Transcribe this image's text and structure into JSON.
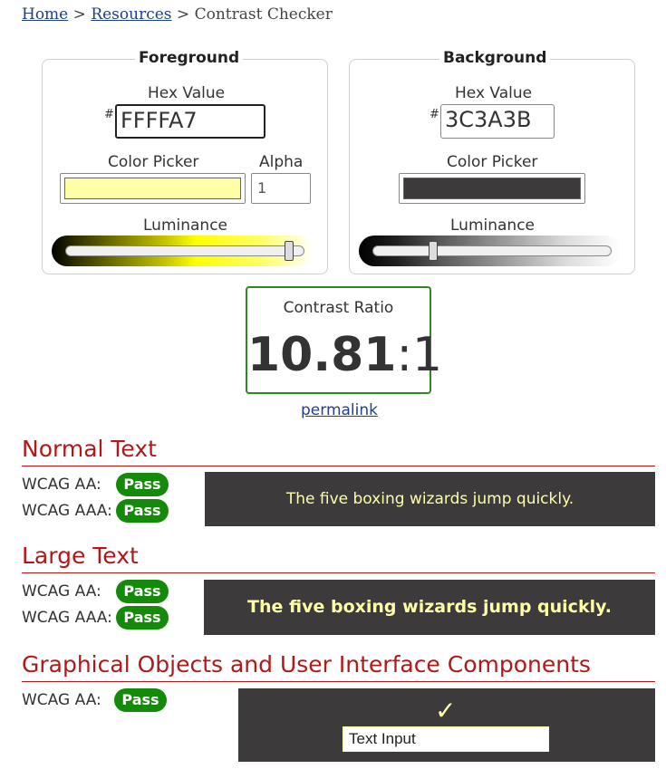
{
  "breadcrumb": {
    "home": "Home",
    "sep1": ">",
    "resources": "Resources",
    "sep2": ">",
    "current": "Contrast Checker"
  },
  "foreground": {
    "legend": "Foreground",
    "hex_label": "Hex Value",
    "hash": "#",
    "hex_value": "FFFFA7",
    "picker_label": "Color Picker",
    "alpha_label": "Alpha",
    "alpha_value": "1",
    "luminance_label": "Luminance",
    "color": "#ffffa7",
    "luminance_level": 0.93
  },
  "background": {
    "legend": "Background",
    "hex_label": "Hex Value",
    "hash": "#",
    "hex_value": "3C3A3B",
    "picker_label": "Color Picker",
    "luminance_label": "Luminance",
    "color": "#3c3a3b",
    "luminance_level": 0.25
  },
  "contrast": {
    "label": "Contrast Ratio",
    "value": "10.81",
    "suffix": ":1",
    "permalink": "permalink"
  },
  "normal_text": {
    "title": "Normal Text",
    "aa_label": "WCAG AA:",
    "aa_result": "Pass",
    "aaa_label": "WCAG AAA:",
    "aaa_result": "Pass",
    "sample": "The five boxing wizards jump quickly."
  },
  "large_text": {
    "title": "Large Text",
    "aa_label": "WCAG AA:",
    "aa_result": "Pass",
    "aaa_label": "WCAG AAA:",
    "aaa_result": "Pass",
    "sample": "The five boxing wizards jump quickly."
  },
  "graphical": {
    "title": "Graphical Objects and User Interface Components",
    "aa_label": "WCAG AA:",
    "aa_result": "Pass",
    "check_icon": "✓",
    "input_text": "Text Input"
  },
  "colors": {
    "pass": "#138a08",
    "heading": "#b01919",
    "link": "#1f3f8f",
    "ratio_border": "#2a8a1e"
  }
}
